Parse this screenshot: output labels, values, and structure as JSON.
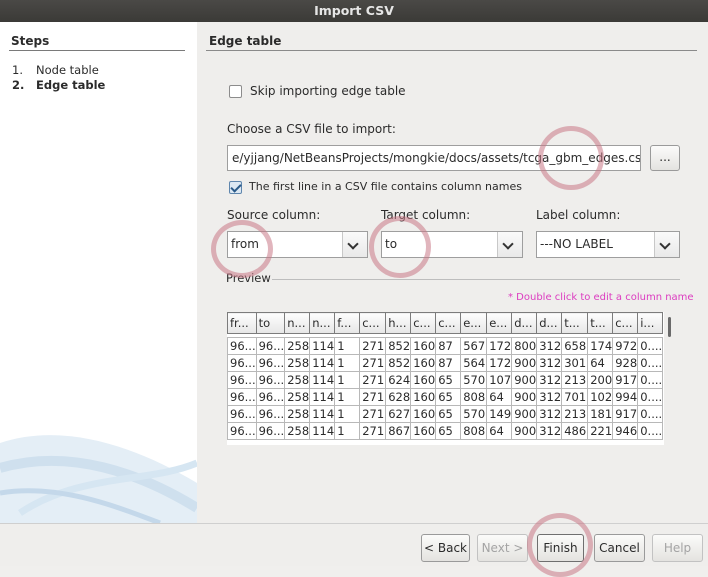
{
  "window": {
    "title": "Import CSV"
  },
  "steps": {
    "title": "Steps",
    "items": [
      {
        "num": "1.",
        "label": "Node table",
        "active": false
      },
      {
        "num": "2.",
        "label": "Edge table",
        "active": true
      }
    ]
  },
  "panel": {
    "title": "Edge table",
    "skip_label": "Skip importing edge table",
    "skip_checked": false,
    "file_prompt": "Choose a CSV file to import:",
    "file_path": "e/yjjang/NetBeansProjects/mongkie/docs/assets/tcga_gbm_edges.csv",
    "browse_label": "...",
    "first_line_label": "The first line in a CSV file contains column names",
    "first_line_checked": true,
    "source_label": "Source column:",
    "source_value": "from",
    "target_label": "Target column:",
    "target_value": "to",
    "label_col_label": "Label column:",
    "label_col_value": "---NO LABEL",
    "preview_label": "Preview",
    "edit_hint": "* Double click to edit a column name"
  },
  "preview": {
    "headers": [
      "fr...",
      "to",
      "n...",
      "n...",
      "f...",
      "c...",
      "h...",
      "c...",
      "c...",
      "e...",
      "e...",
      "d...",
      "d...",
      "t...",
      "t...",
      "c...",
      "i..."
    ],
    "rows": [
      [
        "96...",
        "96...",
        "258",
        "114",
        "1",
        "271",
        "852",
        "160",
        "87",
        "567",
        "172",
        "800",
        "312",
        "658",
        "174",
        "972",
        "0...."
      ],
      [
        "96...",
        "96...",
        "258",
        "114",
        "1",
        "271",
        "852",
        "160",
        "87",
        "564",
        "172",
        "900",
        "312",
        "301",
        "64",
        "928",
        "0...."
      ],
      [
        "96...",
        "96...",
        "258",
        "114",
        "1",
        "271",
        "624",
        "160",
        "65",
        "570",
        "107",
        "900",
        "312",
        "213",
        "200",
        "917",
        "0...."
      ],
      [
        "96...",
        "96...",
        "258",
        "114",
        "1",
        "271",
        "628",
        "160",
        "65",
        "808",
        "64",
        "900",
        "312",
        "701",
        "102",
        "994",
        "0...."
      ],
      [
        "96...",
        "96...",
        "258",
        "114",
        "1",
        "271",
        "627",
        "160",
        "65",
        "570",
        "149",
        "900",
        "312",
        "213",
        "181",
        "917",
        "0...."
      ],
      [
        "96...",
        "96...",
        "258",
        "114",
        "1",
        "271",
        "867",
        "160",
        "65",
        "808",
        "64",
        "900",
        "312",
        "486",
        "221",
        "946",
        "0...."
      ]
    ]
  },
  "footer": {
    "back_label": "< Back",
    "next_label": "Next >",
    "finish_label": "Finish",
    "cancel_label": "Cancel",
    "help_label": "Help"
  }
}
